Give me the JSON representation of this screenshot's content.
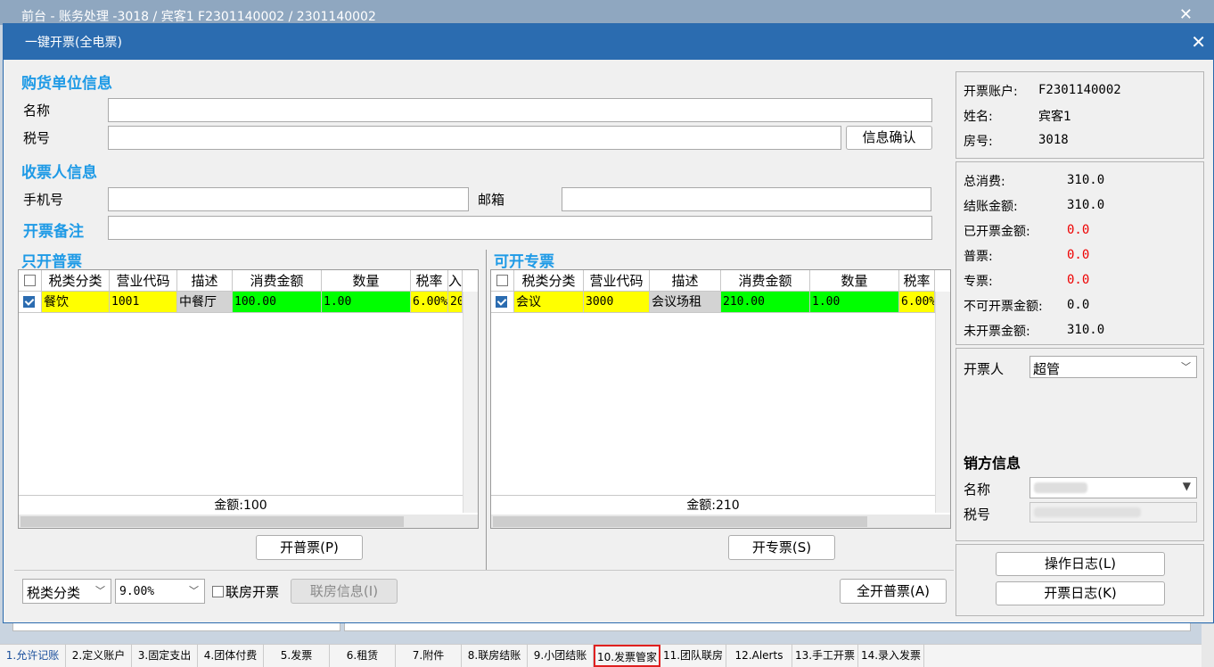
{
  "outer_window": {
    "title": "前台 - 账务处理 -3018 / 宾客1 F2301140002 / 2301140002"
  },
  "dialog": {
    "title": "一键开票(全电票)"
  },
  "buyer": {
    "section_title": "购货单位信息",
    "name_label": "名称",
    "name_value": "",
    "tax_label": "税号",
    "tax_value": "",
    "confirm_button": "信息确认"
  },
  "receiver": {
    "section_title": "收票人信息",
    "phone_label": "手机号",
    "phone_value": "",
    "email_label": "邮箱",
    "email_value": ""
  },
  "remark": {
    "label": "开票备注",
    "value": ""
  },
  "normal": {
    "section_title": "只开普票",
    "columns": [
      "税类分类",
      "营业代码",
      "描述",
      "消费金额",
      "数量",
      "税率",
      "入"
    ],
    "rows": [
      {
        "category": "餐饮",
        "code": "1001",
        "desc": "中餐厅",
        "amount": "100.00",
        "qty": "1.00",
        "rate": "6.00%",
        "extra": "20"
      }
    ],
    "total": "金额:100",
    "button": "开普票(P)"
  },
  "special": {
    "section_title": "可开专票",
    "columns": [
      "税类分类",
      "营业代码",
      "描述",
      "消费金额",
      "数量",
      "税率"
    ],
    "rows": [
      {
        "category": "会议",
        "code": "3000",
        "desc": "会议场租",
        "amount": "210.00",
        "qty": "1.00",
        "rate": "6.00%"
      }
    ],
    "total": "金额:210",
    "button": "开专票(S)"
  },
  "bottom": {
    "tax_select": "税类分类",
    "rate_select": "9.00%",
    "link_room_label": "联房开票",
    "link_info_button": "联房信息(I)",
    "all_normal_button": "全开普票(A)"
  },
  "account": {
    "account_label": "开票账户:",
    "account_value": "F2301140002",
    "name_label": "姓名:",
    "name_value": "宾客1",
    "room_label": "房号:",
    "room_value": "3018"
  },
  "totals": [
    {
      "label": "总消费:",
      "value": "310.0",
      "color": "#000000"
    },
    {
      "label": "结账金额:",
      "value": "310.0",
      "color": "#000000"
    },
    {
      "label": "已开票金额:",
      "value": "0.0",
      "color": "#e00000"
    },
    {
      "label": "普票:",
      "value": "0.0",
      "color": "#e00000"
    },
    {
      "label": "专票:",
      "value": "0.0",
      "color": "#e00000"
    },
    {
      "label": "不可开票金额:",
      "value": "0.0",
      "color": "#000000"
    },
    {
      "label": "未开票金额:",
      "value": "310.0",
      "color": "#000000"
    }
  ],
  "issuer": {
    "label": "开票人",
    "value": "超管"
  },
  "seller": {
    "section_title": "销方信息",
    "name_label": "名称",
    "tax_label": "税号"
  },
  "logs": {
    "operation_button": "操作日志(L)",
    "invoice_button": "开票日志(K)"
  },
  "tabs": [
    "1.允许记账",
    "2.定义账户",
    "3.固定支出",
    "4.团体付费",
    "5.发票",
    "6.租赁",
    "7.附件",
    "8.联房结账",
    "9.小团结账",
    "10.发票管家",
    "11.团队联房",
    "12.Alerts",
    "13.手工开票",
    "14.录入发票"
  ]
}
